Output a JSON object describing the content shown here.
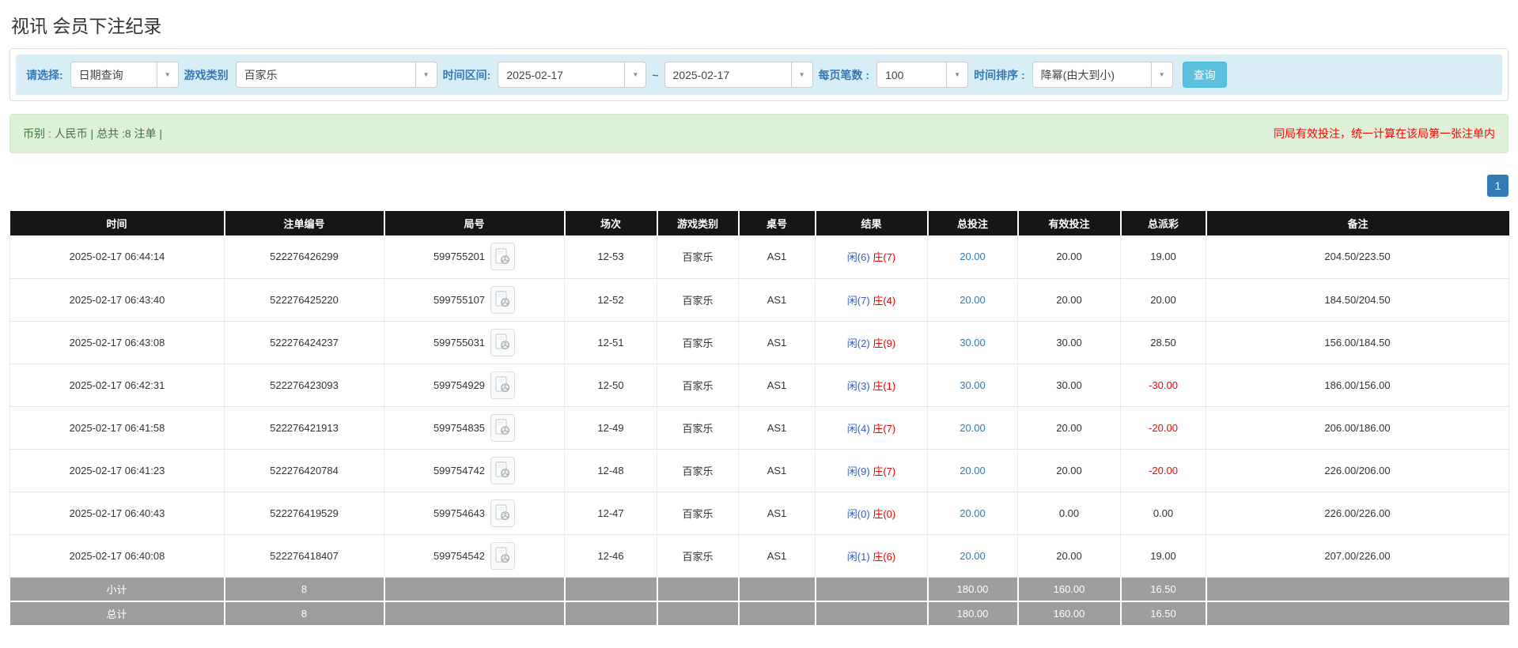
{
  "page_title": "视讯 会员下注纪录",
  "filters": {
    "query_type": {
      "label": "请选择:",
      "value": "日期查询"
    },
    "game_category": {
      "label": "游戏类别",
      "value": "百家乐"
    },
    "time_range": {
      "label": "时间区间:",
      "from": "2025-02-17",
      "separator": "~",
      "to": "2025-02-17"
    },
    "page_size": {
      "label": "每页笔数 :",
      "value": "100"
    },
    "time_sort": {
      "label": "时间排序 :",
      "value": "降幂(由大到小)"
    },
    "query_button": "查询"
  },
  "summary": {
    "left_text": "币别 : 人民币 | 总共 :8 注单 |",
    "note": "同局有效投注，统一计算在该局第一张注单内"
  },
  "pagination": {
    "current_page": "1"
  },
  "colors": {
    "accent_blue": "#337ab7",
    "filter_bar_bg": "#d9edf7",
    "summary_bg": "#dff0d8",
    "header_bg": "#161616",
    "player_blue": "#3359c4",
    "banker_red": "#e60000",
    "negative_red": "#ff0000",
    "query_button_bg": "#5bc0de"
  },
  "icons": {
    "dropdown_caret": "caret-down-icon",
    "round_video": "video-icon"
  },
  "table": {
    "columns": [
      "时间",
      "注单编号",
      "局号",
      "场次",
      "游戏类别",
      "桌号",
      "结果",
      "总投注",
      "有效投注",
      "总派彩",
      "备注"
    ],
    "rows": [
      {
        "time": "2025-02-17 06:44:14",
        "bet_id": "522276426299",
        "round_id": "599755201",
        "session": "12-53",
        "game": "百家乐",
        "table_id": "AS1",
        "result_player": "闲(6)",
        "result_banker": "庄(7)",
        "total_bet": "20.00",
        "valid_bet": "20.00",
        "payout": "19.00",
        "remark": "204.50/223.50"
      },
      {
        "time": "2025-02-17 06:43:40",
        "bet_id": "522276425220",
        "round_id": "599755107",
        "session": "12-52",
        "game": "百家乐",
        "table_id": "AS1",
        "result_player": "闲(7)",
        "result_banker": "庄(4)",
        "total_bet": "20.00",
        "valid_bet": "20.00",
        "payout": "20.00",
        "remark": "184.50/204.50"
      },
      {
        "time": "2025-02-17 06:43:08",
        "bet_id": "522276424237",
        "round_id": "599755031",
        "session": "12-51",
        "game": "百家乐",
        "table_id": "AS1",
        "result_player": "闲(2)",
        "result_banker": "庄(9)",
        "total_bet": "30.00",
        "valid_bet": "30.00",
        "payout": "28.50",
        "remark": "156.00/184.50"
      },
      {
        "time": "2025-02-17 06:42:31",
        "bet_id": "522276423093",
        "round_id": "599754929",
        "session": "12-50",
        "game": "百家乐",
        "table_id": "AS1",
        "result_player": "闲(3)",
        "result_banker": "庄(1)",
        "total_bet": "30.00",
        "valid_bet": "30.00",
        "payout": "-30.00",
        "remark": "186.00/156.00"
      },
      {
        "time": "2025-02-17 06:41:58",
        "bet_id": "522276421913",
        "round_id": "599754835",
        "session": "12-49",
        "game": "百家乐",
        "table_id": "AS1",
        "result_player": "闲(4)",
        "result_banker": "庄(7)",
        "total_bet": "20.00",
        "valid_bet": "20.00",
        "payout": "-20.00",
        "remark": "206.00/186.00"
      },
      {
        "time": "2025-02-17 06:41:23",
        "bet_id": "522276420784",
        "round_id": "599754742",
        "session": "12-48",
        "game": "百家乐",
        "table_id": "AS1",
        "result_player": "闲(9)",
        "result_banker": "庄(7)",
        "total_bet": "20.00",
        "valid_bet": "20.00",
        "payout": "-20.00",
        "remark": "226.00/206.00"
      },
      {
        "time": "2025-02-17 06:40:43",
        "bet_id": "522276419529",
        "round_id": "599754643",
        "session": "12-47",
        "game": "百家乐",
        "table_id": "AS1",
        "result_player": "闲(0)",
        "result_banker": "庄(0)",
        "total_bet": "20.00",
        "valid_bet": "0.00",
        "payout": "0.00",
        "remark": "226.00/226.00"
      },
      {
        "time": "2025-02-17 06:40:08",
        "bet_id": "522276418407",
        "round_id": "599754542",
        "session": "12-46",
        "game": "百家乐",
        "table_id": "AS1",
        "result_player": "闲(1)",
        "result_banker": "庄(6)",
        "total_bet": "20.00",
        "valid_bet": "20.00",
        "payout": "19.00",
        "remark": "207.00/226.00"
      }
    ],
    "subtotal": {
      "label": "小计",
      "count": "8",
      "total_bet": "180.00",
      "valid_bet": "160.00",
      "payout": "16.50"
    },
    "total": {
      "label": "总计",
      "count": "8",
      "total_bet": "180.00",
      "valid_bet": "160.00",
      "payout": "16.50"
    }
  }
}
